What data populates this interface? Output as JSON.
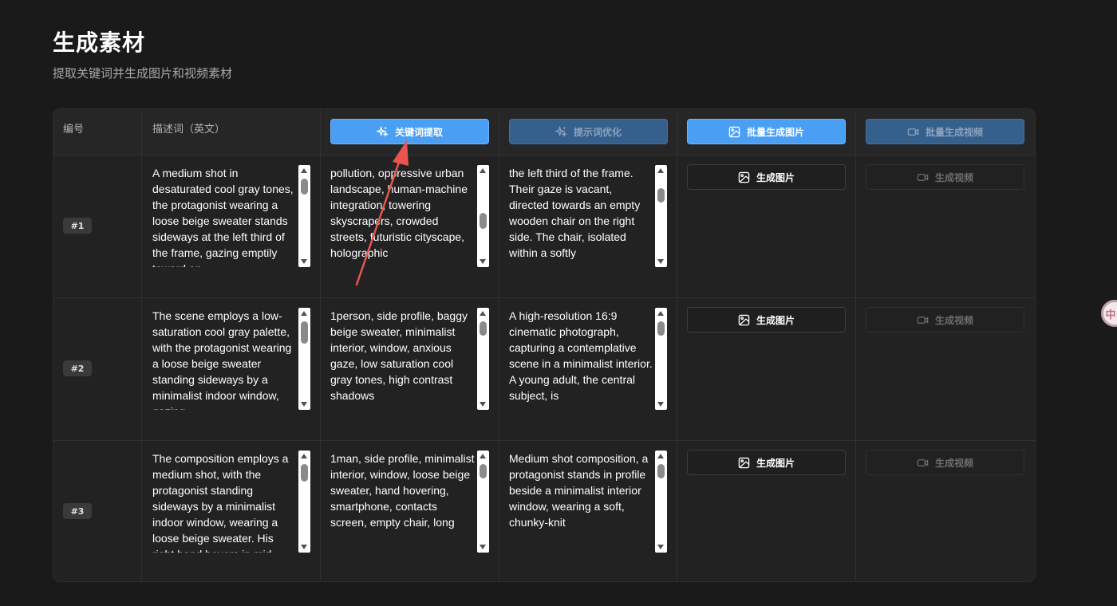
{
  "page": {
    "title": "生成素材",
    "subtitle": "提取关键词并生成图片和视频素材"
  },
  "table": {
    "headers": {
      "number": "编号",
      "description": "描述词（英文）",
      "extract_button": "关键词提取",
      "optimize_button": "提示词优化",
      "batch_image_button": "批量生成图片",
      "batch_video_button": "批量生成视频"
    },
    "rows": [
      {
        "number": "#1",
        "description": "A medium shot in desaturated cool gray tones, the protagonist wearing a loose beige sweater stands sideways at the left third of the frame, gazing emptily toward an",
        "keywords": "pollution, oppressive urban landscape, human-machine integration, towering skyscrapers, crowded streets, futuristic cityscape, holographic",
        "optimized": "the left third of the frame. Their gaze is vacant, directed towards an empty wooden chair on the right side. The chair, isolated within a softly",
        "image_button": "生成图片",
        "video_button": "生成视频"
      },
      {
        "number": "#2",
        "description": "The scene employs a low-saturation cool gray palette, with the protagonist wearing a loose beige sweater standing sideways by a minimalist indoor window, gazing",
        "keywords": "1person, side profile, baggy beige sweater, minimalist interior, window, anxious gaze, low saturation cool gray tones, high contrast shadows",
        "optimized": "A high-resolution 16:9 cinematic photograph, capturing a contemplative scene in a minimalist interior. A young adult, the central subject, is",
        "image_button": "生成图片",
        "video_button": "生成视频"
      },
      {
        "number": "#3",
        "description": "The composition employs a medium shot, with the protagonist standing sideways by a minimalist indoor window, wearing a loose beige sweater. His right hand hovers in mid",
        "keywords": "1man, side profile, minimalist interior, window, loose beige sweater, hand hovering, smartphone, contacts screen, empty chair, long",
        "optimized": "Medium shot composition, a protagonist stands in profile beside a minimalist interior window, wearing a soft, chunky-knit",
        "image_button": "生成图片",
        "video_button": "生成视频"
      }
    ]
  },
  "side_widget": {
    "label": "中"
  },
  "colors": {
    "background": "#1a1a1a",
    "table_bg": "#222222",
    "primary": "#4a9ff5",
    "disabled": "#35608e",
    "annotation_arrow": "#e8554e"
  }
}
